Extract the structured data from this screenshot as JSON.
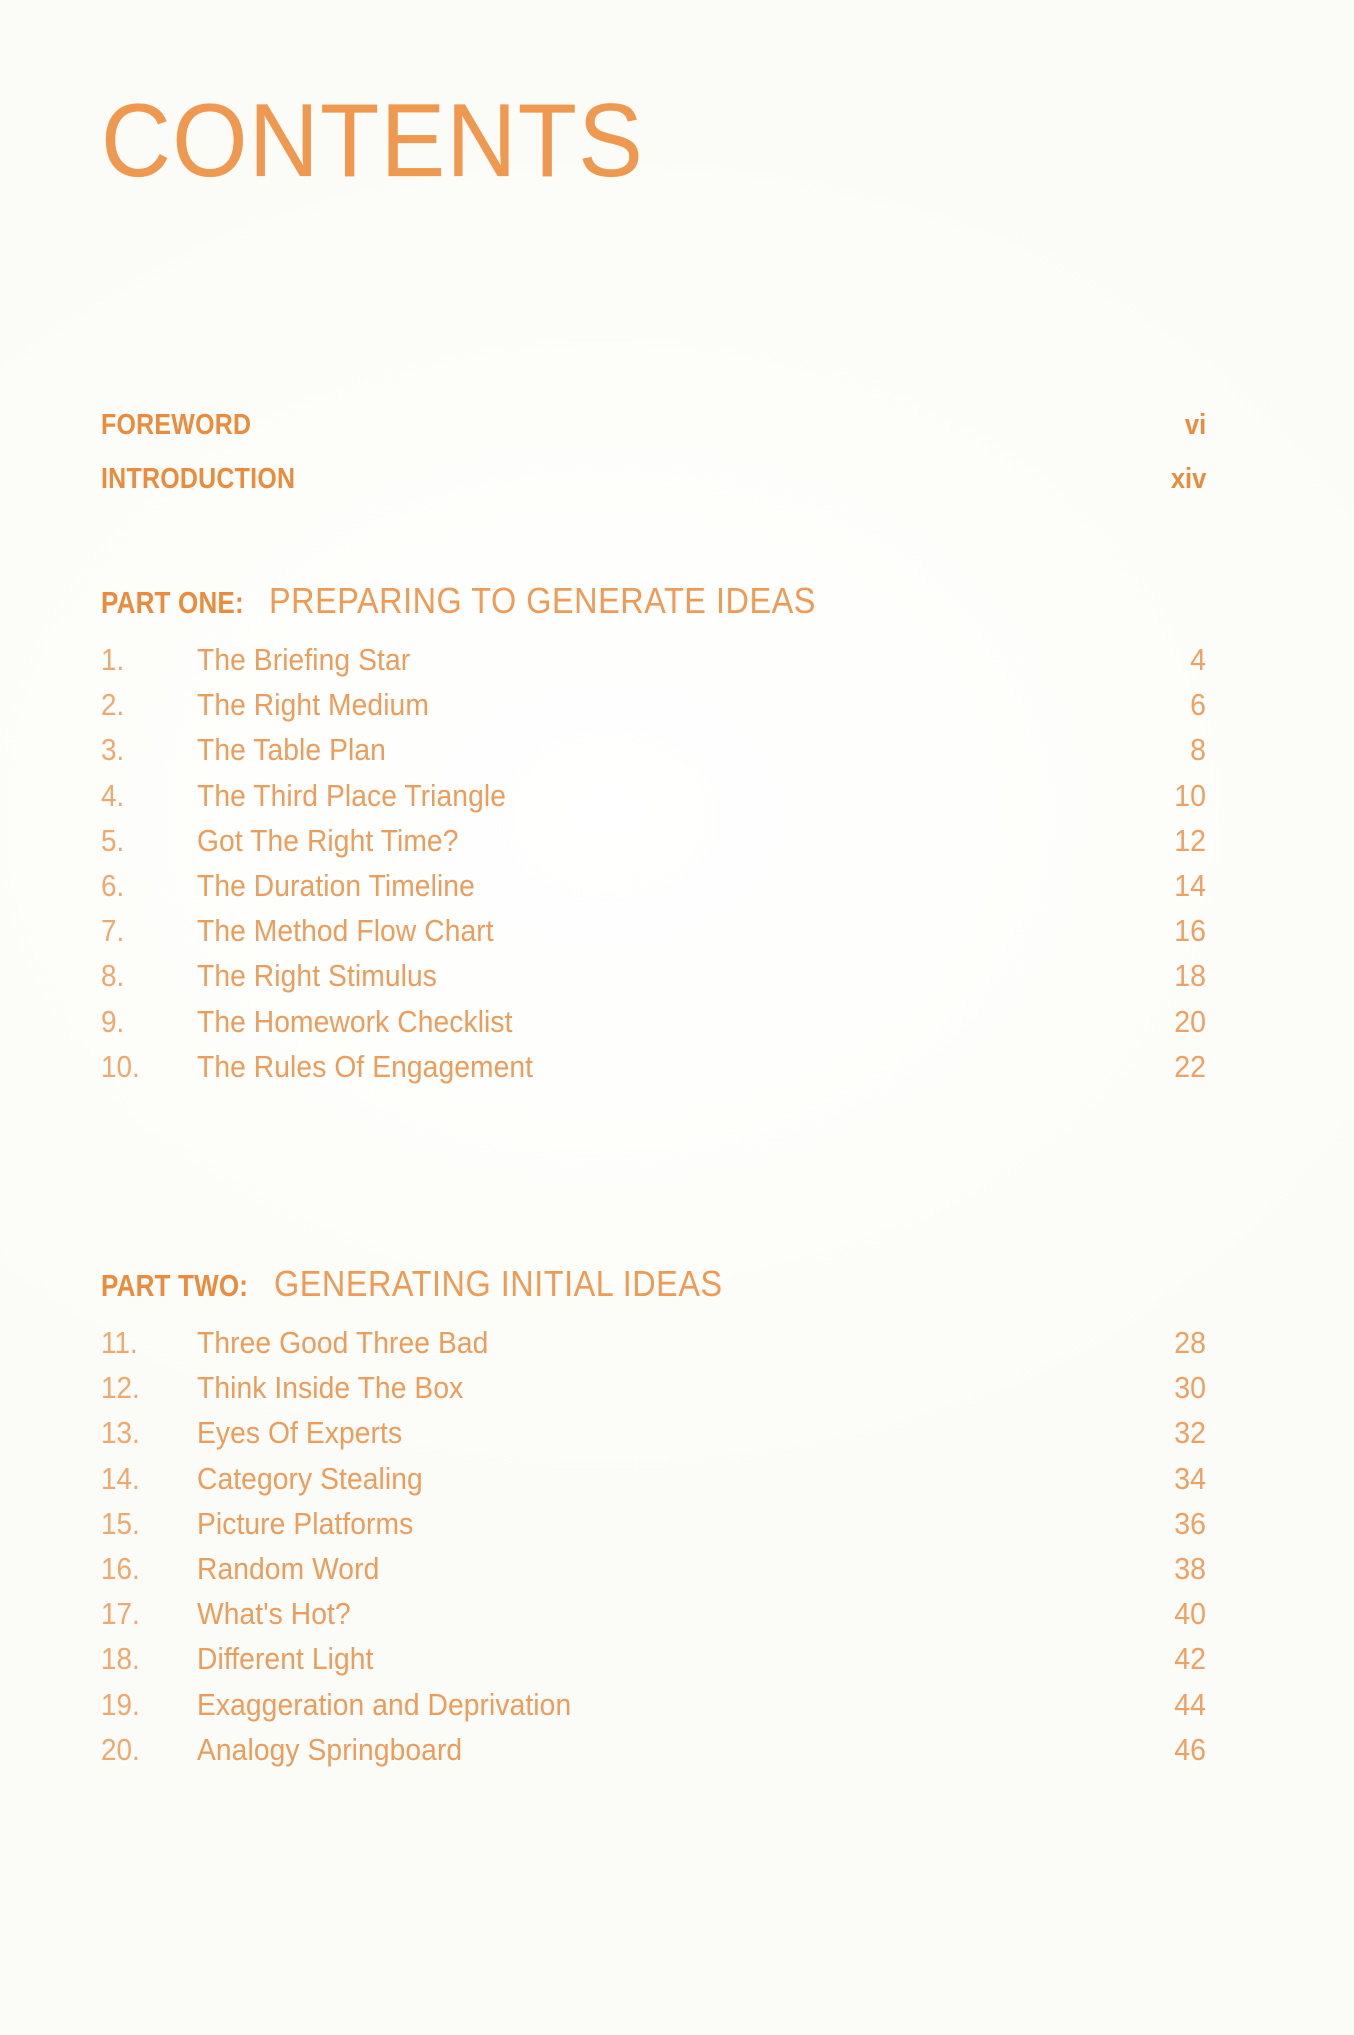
{
  "page": {
    "title": "CONTENTS",
    "background_color": "#fefefc",
    "accent_color": "#e98c3e",
    "body_text_color": "#eb9d5c"
  },
  "frontmatter": [
    {
      "label": "FOREWORD",
      "page": "vi"
    },
    {
      "label": "INTRODUCTION",
      "page": "xiv"
    }
  ],
  "parts": [
    {
      "label": "PART ONE:",
      "name": "PREPARING TO GENERATE IDEAS",
      "entries": [
        {
          "num": "1.",
          "title": "The Briefing Star",
          "page": "4"
        },
        {
          "num": "2.",
          "title": "The Right Medium",
          "page": "6"
        },
        {
          "num": "3.",
          "title": "The Table Plan",
          "page": "8"
        },
        {
          "num": "4.",
          "title": "The Third Place Triangle",
          "page": "10"
        },
        {
          "num": "5.",
          "title": "Got The Right Time?",
          "page": "12"
        },
        {
          "num": "6.",
          "title": "The Duration Timeline",
          "page": "14"
        },
        {
          "num": "7.",
          "title": "The Method Flow Chart",
          "page": "16"
        },
        {
          "num": "8.",
          "title": "The Right Stimulus",
          "page": "18"
        },
        {
          "num": "9.",
          "title": "The Homework Checklist",
          "page": "20"
        },
        {
          "num": "10.",
          "title": "The Rules Of Engagement",
          "page": "22"
        }
      ]
    },
    {
      "label": "PART TWO:",
      "name": "GENERATING INITIAL IDEAS",
      "entries": [
        {
          "num": "11.",
          "title": "Three Good Three Bad",
          "page": "28"
        },
        {
          "num": "12.",
          "title": "Think Inside The Box",
          "page": "30"
        },
        {
          "num": "13.",
          "title": "Eyes Of Experts",
          "page": "32"
        },
        {
          "num": "14.",
          "title": "Category Stealing",
          "page": "34"
        },
        {
          "num": "15.",
          "title": "Picture Platforms",
          "page": "36"
        },
        {
          "num": "16.",
          "title": "Random Word",
          "page": "38"
        },
        {
          "num": "17.",
          "title": "What's Hot?",
          "page": "40"
        },
        {
          "num": "18.",
          "title": "Different Light",
          "page": "42"
        },
        {
          "num": "19.",
          "title": "Exaggeration and Deprivation",
          "page": "44"
        },
        {
          "num": "20.",
          "title": "Analogy Springboard",
          "page": "46"
        }
      ]
    }
  ]
}
